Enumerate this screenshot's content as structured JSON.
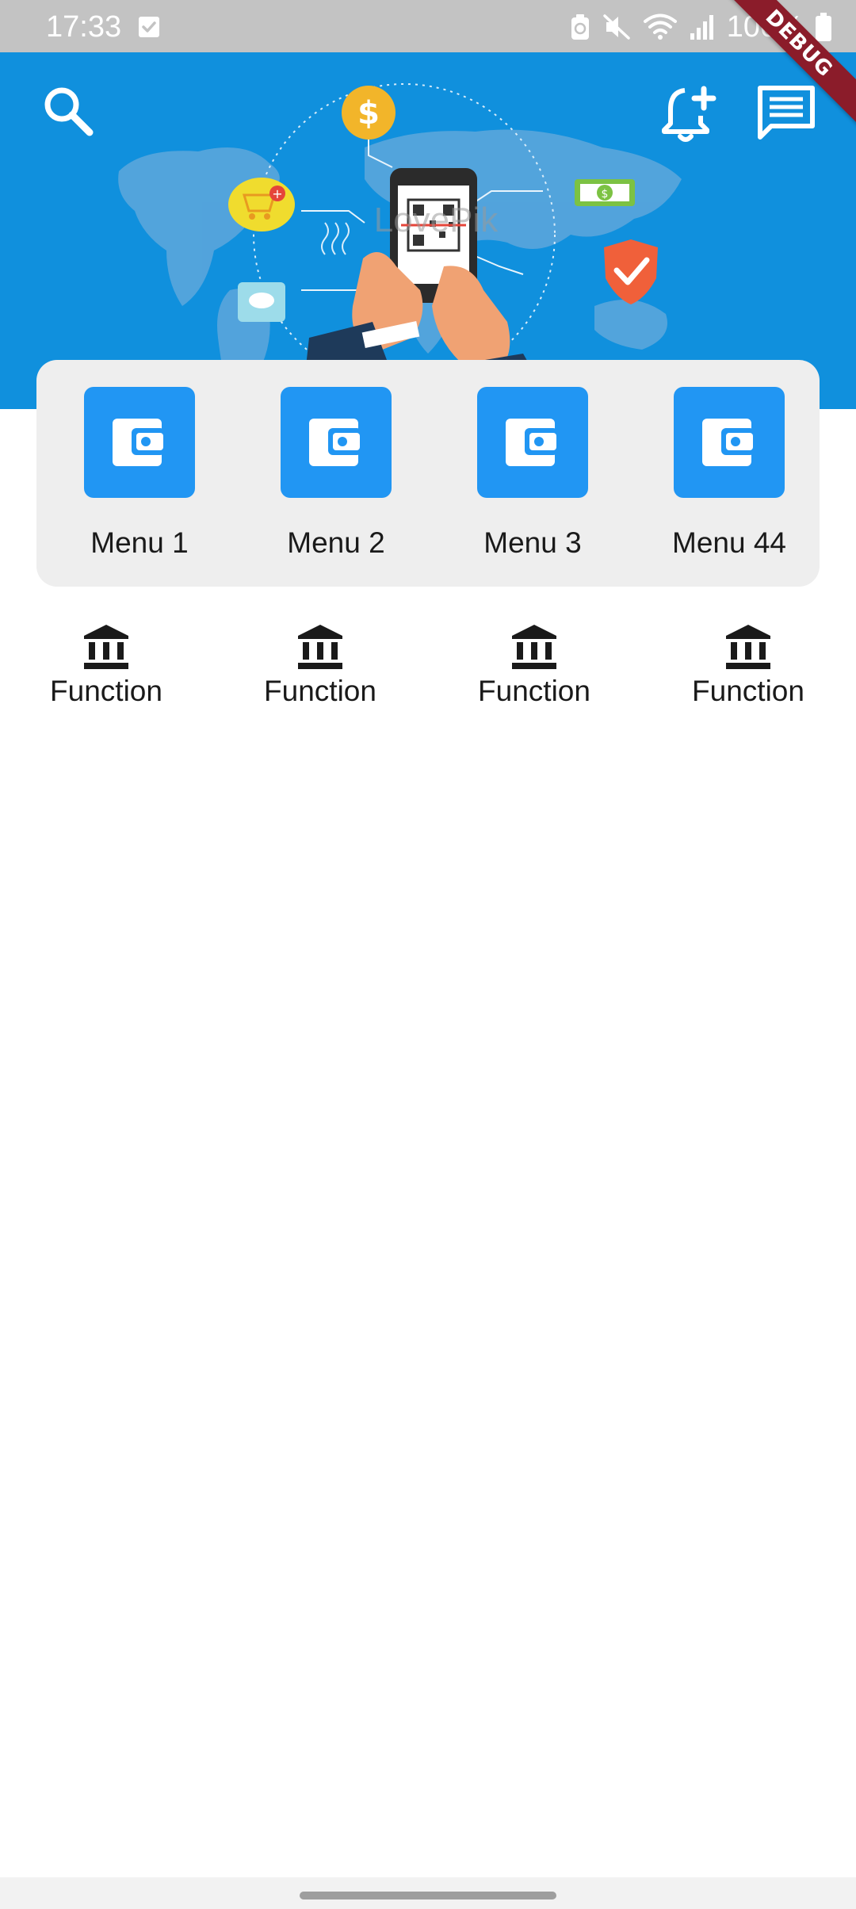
{
  "status_bar": {
    "time": "17:33",
    "battery": "100%"
  },
  "header": {
    "icons": [
      "search-icon",
      "notification-add-icon",
      "message-icon"
    ],
    "background_color": "#1090dd",
    "debug_banner": "DEBUG"
  },
  "banner_illustration": {
    "watermark": "LovePik"
  },
  "menu": {
    "items": [
      {
        "label": "Menu 1",
        "icon": "wallet-icon"
      },
      {
        "label": "Menu 2",
        "icon": "wallet-icon"
      },
      {
        "label": "Menu 3",
        "icon": "wallet-icon"
      },
      {
        "label": "Menu 44",
        "icon": "wallet-icon"
      }
    ],
    "accent_color": "#2196f3"
  },
  "functions": {
    "items": [
      {
        "label": "Function",
        "icon": "bank-icon"
      },
      {
        "label": "Function",
        "icon": "bank-icon"
      },
      {
        "label": "Function",
        "icon": "bank-icon"
      },
      {
        "label": "Function",
        "icon": "bank-icon"
      }
    ]
  }
}
